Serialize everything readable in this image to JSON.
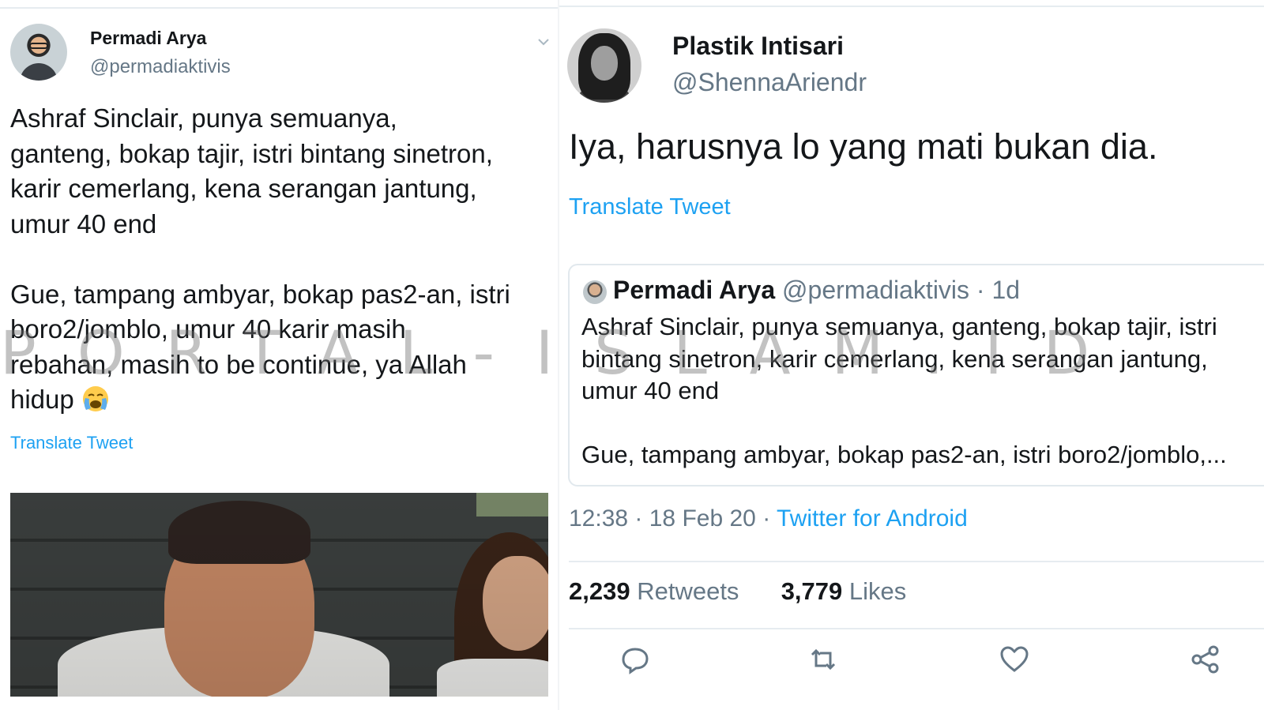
{
  "left_tweet": {
    "display_name": "Permadi Arya",
    "handle": "@permadiaktivis",
    "text": "Ashraf Sinclair, punya semuanya,\nganteng, bokap tajir, istri bintang sinetron,\nkarir cemerlang, kena serangan jantung,\numur 40 end\n\nGue, tampang ambyar, bokap pas2-an, istri\nboro2/jomblo, umur 40 karir masih\nrebahan, masih to be continue, ya Allah\nhidup",
    "emoji": "crying-face-emoji",
    "translate_label": "Translate Tweet",
    "photo": "photo of man in white shirt and woman"
  },
  "right_tweet": {
    "display_name": "Plastik Intisari",
    "handle": "@ShennaAriendr",
    "text": "Iya, harusnya lo yang mati bukan dia.",
    "translate_label": "Translate Tweet",
    "quoted": {
      "display_name": "Permadi Arya",
      "handle": "@permadiaktivis",
      "age": "· 1d",
      "text": "Ashraf Sinclair, punya semuanya, ganteng, bokap tajir, istri\nbintang sinetron, karir cemerlang, kena serangan jantung,\numur 40 end\n\nGue, tampang ambyar, bokap pas2-an, istri boro2/jomblo,..."
    },
    "time": "12:38",
    "date": "18 Feb 20",
    "source": "Twitter for Android",
    "retweets_count": "2,239",
    "retweets_label": "Retweets",
    "likes_count": "3,779",
    "likes_label": "Likes",
    "actions": [
      "reply-icon",
      "retweet-icon",
      "like-icon",
      "share-icon"
    ]
  },
  "watermark": "PORTAL-ISLAM.ID",
  "colors": {
    "link": "#1da1f2",
    "secondary": "#657786",
    "text": "#14171a",
    "border": "#e6ecf0"
  }
}
